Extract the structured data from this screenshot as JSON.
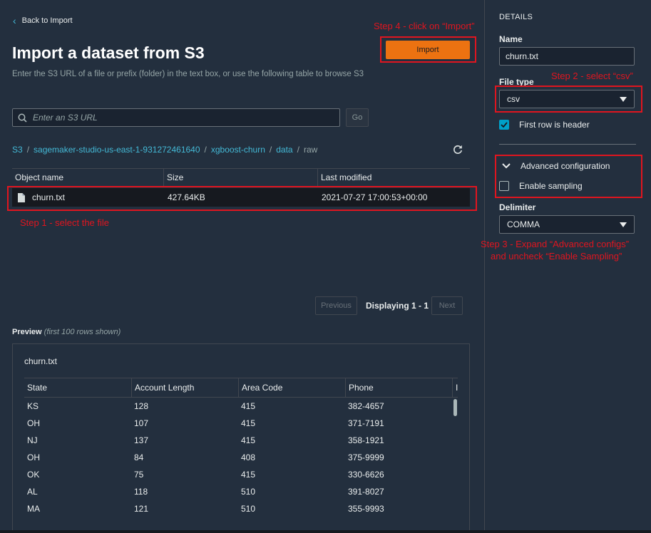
{
  "nav": {
    "back_label": "Back to Import"
  },
  "header": {
    "title": "Import a dataset from S3",
    "description": "Enter the S3 URL of a file or prefix (folder) in the text box, or use the following table to browse S3",
    "import_label": "Import"
  },
  "search": {
    "placeholder": "Enter an S3 URL",
    "go_label": "Go"
  },
  "breadcrumb": {
    "items": [
      "S3",
      "sagemaker-studio-us-east-1-931272461640",
      "xgboost-churn",
      "data",
      "raw"
    ],
    "separator": "/"
  },
  "s3table": {
    "columns": [
      "Object name",
      "Size",
      "Last modified"
    ],
    "rows": [
      {
        "name": "churn.txt",
        "size": "427.64KB",
        "modified": "2021-07-27 17:00:53+00:00"
      }
    ]
  },
  "pagination": {
    "prev": "Previous",
    "status": "Displaying 1 - 1",
    "next": "Next"
  },
  "preview": {
    "label": "Preview",
    "note": "(first 100 rows shown)",
    "file_name": "churn.txt",
    "columns": [
      "State",
      "Account Length",
      "Area Code",
      "Phone",
      "I"
    ],
    "rows": [
      [
        "KS",
        "128",
        "415",
        "382-4657"
      ],
      [
        "OH",
        "107",
        "415",
        "371-7191"
      ],
      [
        "NJ",
        "137",
        "415",
        "358-1921"
      ],
      [
        "OH",
        "84",
        "408",
        "375-9999"
      ],
      [
        "OK",
        "75",
        "415",
        "330-6626"
      ],
      [
        "AL",
        "118",
        "510",
        "391-8027"
      ],
      [
        "MA",
        "121",
        "510",
        "355-9993"
      ]
    ]
  },
  "details": {
    "heading": "DETAILS",
    "name_label": "Name",
    "name_value": "churn.txt",
    "file_type_label": "File type",
    "file_type_value": "csv",
    "first_row_header_label": "First row is header",
    "first_row_header_checked": true,
    "advanced_label": "Advanced configuration",
    "enable_sampling_label": "Enable sampling",
    "enable_sampling_checked": false,
    "delimiter_label": "Delimiter",
    "delimiter_value": "COMMA"
  },
  "annotations": {
    "step1": "Step 1 - select the file",
    "step2": "Step 2 - select “csv”",
    "step3_line1": "Step 3 - Expand “Advanced configs”",
    "step3_line2": "and uncheck “Enable Sampling”",
    "step4": "Step 4 - click on “Import”"
  },
  "colors": {
    "background": "#232f3e",
    "accent": "#ec7211",
    "link": "#44b9d6",
    "annotation": "#e0151f",
    "checkbox": "#00a1c9"
  }
}
